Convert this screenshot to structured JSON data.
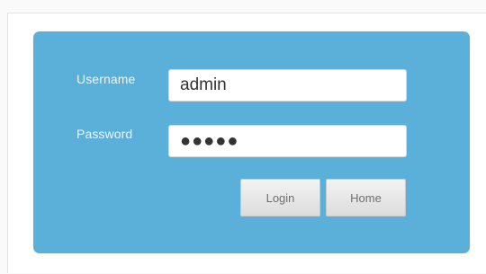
{
  "login_form": {
    "username_label": "Username",
    "username_value": "admin",
    "password_label": "Password",
    "password_value": "●●●●●",
    "login_button": "Login",
    "home_button": "Home"
  },
  "colors": {
    "panel_background": "#5bb0d9",
    "page_background": "#ffffff",
    "button_background": "#e5e5e5"
  }
}
